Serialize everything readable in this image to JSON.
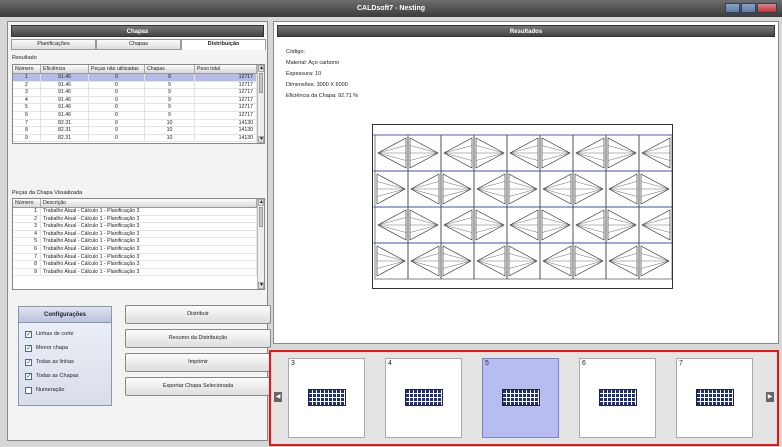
{
  "window": {
    "title": "CALDsoft7 - Nesting"
  },
  "left_panel": {
    "title": "Chapas",
    "tabs": [
      {
        "label": "Planificações"
      },
      {
        "label": "Chapas"
      },
      {
        "label": "Distribuição"
      }
    ],
    "results_label": "Resultado",
    "results_table": {
      "columns": [
        "Número",
        "Eficiência",
        "Peças não utilizadas",
        "Chapas",
        "Peso total"
      ],
      "rows": [
        [
          "1",
          "91.46",
          "0",
          "9",
          "12717"
        ],
        [
          "2",
          "91.46",
          "0",
          "9",
          "12717"
        ],
        [
          "3",
          "91.46",
          "0",
          "9",
          "12717"
        ],
        [
          "4",
          "91.46",
          "0",
          "9",
          "12717"
        ],
        [
          "5",
          "91.46",
          "0",
          "9",
          "12717"
        ],
        [
          "6",
          "91.46",
          "0",
          "9",
          "12717"
        ],
        [
          "7",
          "82.31",
          "0",
          "10",
          "14130"
        ],
        [
          "8",
          "82.31",
          "0",
          "10",
          "14130"
        ],
        [
          "9",
          "82.31",
          "0",
          "10",
          "14130"
        ]
      ]
    },
    "pieces_label": "Peças da Chapa Visualizada",
    "pieces_table": {
      "columns": [
        "Número",
        "Descrição"
      ],
      "rows": [
        [
          "1",
          "Trabalho Atual - Cálculo 1 - Planificação 3"
        ],
        [
          "2",
          "Trabalho Atual - Cálculo 1 - Planificação 3"
        ],
        [
          "3",
          "Trabalho Atual - Cálculo 1 - Planificação 3"
        ],
        [
          "4",
          "Trabalho Atual - Cálculo 1 - Planificação 3"
        ],
        [
          "5",
          "Trabalho Atual - Cálculo 1 - Planificação 3"
        ],
        [
          "6",
          "Trabalho Atual - Cálculo 1 - Planificação 3"
        ],
        [
          "7",
          "Trabalho Atual - Cálculo 1 - Planificação 3"
        ],
        [
          "8",
          "Trabalho Atual - Cálculo 1 - Planificação 3"
        ],
        [
          "9",
          "Trabalho Atual - Cálculo 1 - Planificação 3"
        ]
      ]
    },
    "config": {
      "title": "Configurações",
      "options": [
        {
          "label": "Linhas de corte",
          "checked": true
        },
        {
          "label": "Menor chapa",
          "checked": true
        },
        {
          "label": "Todas as linhas",
          "checked": true
        },
        {
          "label": "Todas as Chapas",
          "checked": true
        },
        {
          "label": "Numeração",
          "checked": false
        }
      ]
    },
    "buttons": {
      "distribute": "Distribuir",
      "summary": "Resumo da Distribuição",
      "print": "Imprimir",
      "export": "Exportar Chapa Selecionada"
    }
  },
  "right_panel": {
    "title": "Resultados",
    "info": {
      "code": "Código:",
      "material": "Material: Aço carbono",
      "thickness": "Espessura: 10",
      "dimensions": "Dimensões: 3000 X 6000",
      "efficiency": "Eficiência da Chapa: 92.71 %"
    },
    "sheet": {
      "columns": 9,
      "rows": 4
    }
  },
  "thumbnails": [
    {
      "num": "3",
      "selected": false
    },
    {
      "num": "4",
      "selected": false
    },
    {
      "num": "5",
      "selected": true
    },
    {
      "num": "6",
      "selected": false
    },
    {
      "num": "7",
      "selected": false
    }
  ],
  "colors": {
    "selection": "#b4bbe8",
    "highlight_border": "#e11111",
    "nest_fill": "#1d2e7a"
  },
  "icons": {
    "scroll_left": "arrow-left-icon",
    "scroll_right": "arrow-right-icon",
    "check": "checkmark-icon"
  }
}
